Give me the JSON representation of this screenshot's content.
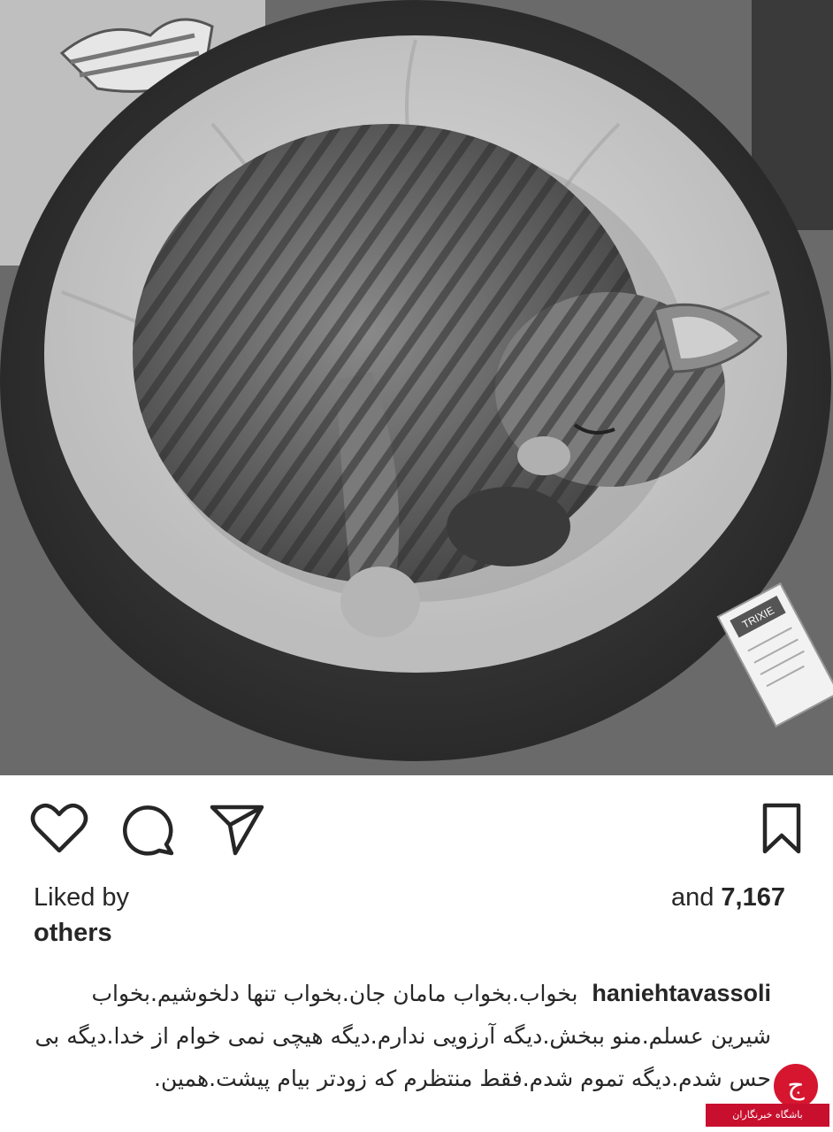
{
  "post": {
    "image_alt": "Tabby cat sleeping curled up in a round pet bed",
    "tag_text": "TRIXIE"
  },
  "actions": {
    "like_icon": "heart-icon",
    "comment_icon": "comment-icon",
    "share_icon": "send-icon",
    "save_icon": "bookmark-icon"
  },
  "likes": {
    "liked_by": "Liked by",
    "and_prefix": "and",
    "count": "7,167",
    "others": "others"
  },
  "caption": {
    "username": "haniehtavassoli",
    "text": "بخواب.بخواب مامان جان.بخواب تنها دلخوشیم.بخواب شیرین عسلم.منو ببخش.دیگه آرزویی ندارم.دیگه هیچی نمی خوام از خدا.دیگه بی حس شدم.دیگه تموم شدم.فقط منتظرم که زودتر بیام پیشت.همین."
  },
  "watermark": {
    "label": "باشگاه خبرنگاران",
    "logo_glyph": "ج"
  },
  "colors": {
    "text": "#262626",
    "watermark_red": "#c8102e"
  }
}
